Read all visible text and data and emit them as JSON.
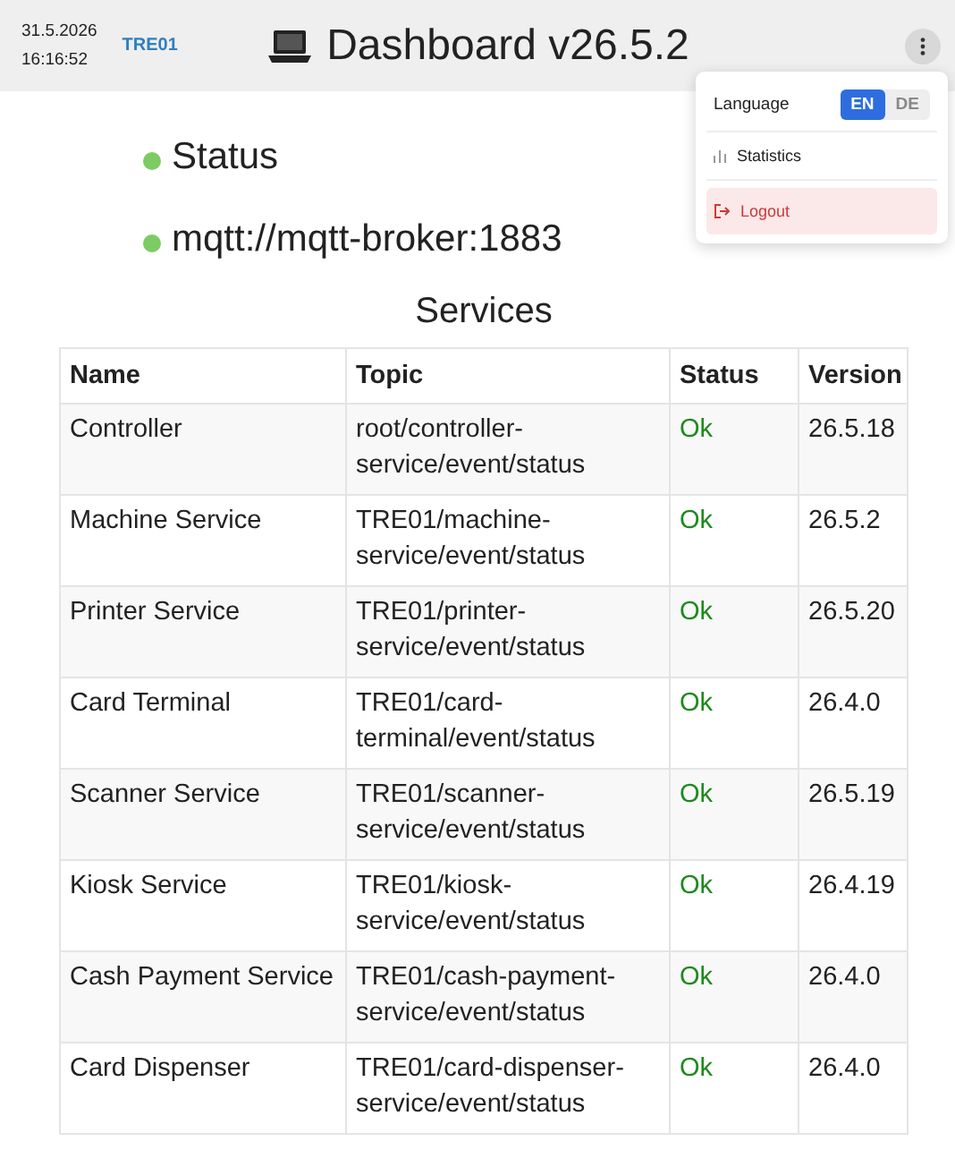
{
  "header": {
    "date": "31.5.2026",
    "time": "16:16:52",
    "station": "TRE01",
    "title": "Dashboard v26.5.2"
  },
  "menu": {
    "language_label": "Language",
    "languages": [
      {
        "label": "EN",
        "selected": true
      },
      {
        "label": "DE",
        "selected": false
      }
    ],
    "items": [
      {
        "kind": "statistics",
        "label": "Statistics"
      },
      {
        "kind": "logout",
        "label": "Logout"
      }
    ]
  },
  "indicators": [
    {
      "label": "Status",
      "color": "#7ccb63"
    },
    {
      "label": "mqtt://mqtt-broker:1883",
      "color": "#7ccb63"
    }
  ],
  "services": {
    "title": "Services",
    "columns": [
      "Name",
      "Topic",
      "Status",
      "Version"
    ],
    "rows": [
      {
        "name": "Controller",
        "topic": "root/controller-service/event/status",
        "status": "Ok",
        "ok": true,
        "version": "26.5.18"
      },
      {
        "name": "Machine Service",
        "topic": "TRE01/machine-service/event/status",
        "status": "Ok",
        "ok": true,
        "version": "26.5.2"
      },
      {
        "name": "Printer Service",
        "topic": "TRE01/printer-service/event/status",
        "status": "Ok",
        "ok": true,
        "version": "26.5.20"
      },
      {
        "name": "Card Terminal",
        "topic": "TRE01/card-terminal/event/status",
        "status": "Ok",
        "ok": true,
        "version": "26.4.0"
      },
      {
        "name": "Scanner Service",
        "topic": "TRE01/scanner-service/event/status",
        "status": "Ok",
        "ok": true,
        "version": "26.5.19"
      },
      {
        "name": "Kiosk Service",
        "topic": "TRE01/kiosk-service/event/status",
        "status": "Ok",
        "ok": true,
        "version": "26.4.19"
      },
      {
        "name": "Cash Payment Service",
        "topic": "TRE01/cash-payment-service/event/status",
        "status": "Ok",
        "ok": true,
        "version": "26.4.0"
      },
      {
        "name": "Card Dispenser",
        "topic": "TRE01/card-dispenser-service/event/status",
        "status": "Ok",
        "ok": true,
        "version": "26.4.0"
      }
    ]
  }
}
